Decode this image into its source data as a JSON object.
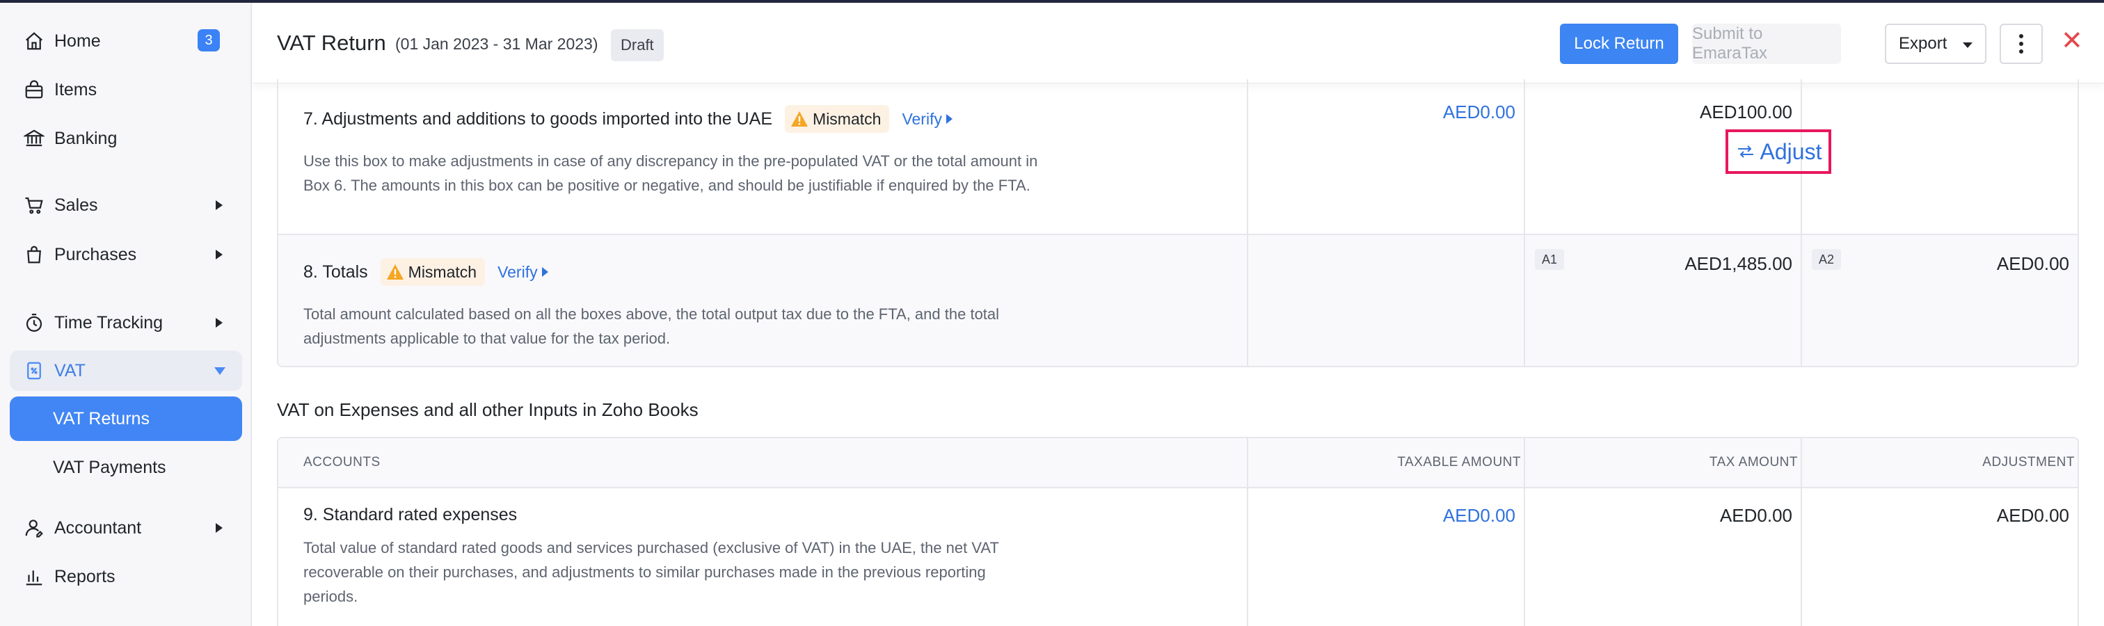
{
  "sidebar": {
    "home": "Home",
    "home_badge": "3",
    "items": "Items",
    "banking": "Banking",
    "sales": "Sales",
    "purchases": "Purchases",
    "time_tracking": "Time Tracking",
    "vat": "VAT",
    "vat_returns": "VAT Returns",
    "vat_payments": "VAT Payments",
    "accountant": "Accountant",
    "reports": "Reports"
  },
  "header": {
    "title": "VAT Return",
    "period": "(01 Jan 2023 - 31 Mar 2023)",
    "status": "Draft",
    "lock_label": "Lock Return",
    "submit_label": "Submit to EmaraTax",
    "export_label": "Export",
    "close_glyph": "✕"
  },
  "rows": {
    "r7": {
      "title": "7. Adjustments and additions to goods imported into the UAE",
      "mismatch": "Mismatch",
      "verify": "Verify",
      "desc": "Use this box to make adjustments in case of any discrepancy in the pre-populated VAT or the total amount in Box 6. The amounts in this box can be positive or negative, and should be justifiable if enquired by the FTA.",
      "taxable": "AED0.00",
      "tax": "AED100.00",
      "adjust": "Adjust"
    },
    "r8": {
      "title": "8. Totals",
      "mismatch": "Mismatch",
      "verify": "Verify",
      "desc": "Total amount calculated based on all the boxes above, the total output tax due to the FTA, and the total adjustments applicable to that value for the tax period.",
      "tag_a1": "A1",
      "tax": "AED1,485.00",
      "tag_a2": "A2",
      "adjustment": "AED0.00"
    }
  },
  "expenses": {
    "section_title": "VAT on Expenses and all other Inputs in Zoho Books",
    "headers": {
      "accounts": "ACCOUNTS",
      "taxable": "TAXABLE AMOUNT",
      "tax": "TAX AMOUNT",
      "adjustment": "ADJUSTMENT"
    },
    "r9": {
      "title": "9. Standard rated expenses",
      "desc": "Total value of standard rated goods and services purchased (exclusive of VAT) in the UAE, the net VAT recoverable on their purchases, and adjustments to similar purchases made in the previous reporting periods.",
      "taxable": "AED0.00",
      "tax": "AED0.00",
      "adjustment": "AED0.00"
    }
  },
  "colors": {
    "accent": "#3c85f2",
    "link": "#2f72de",
    "highlight": "#e8175d",
    "warning": "#f5a623"
  }
}
